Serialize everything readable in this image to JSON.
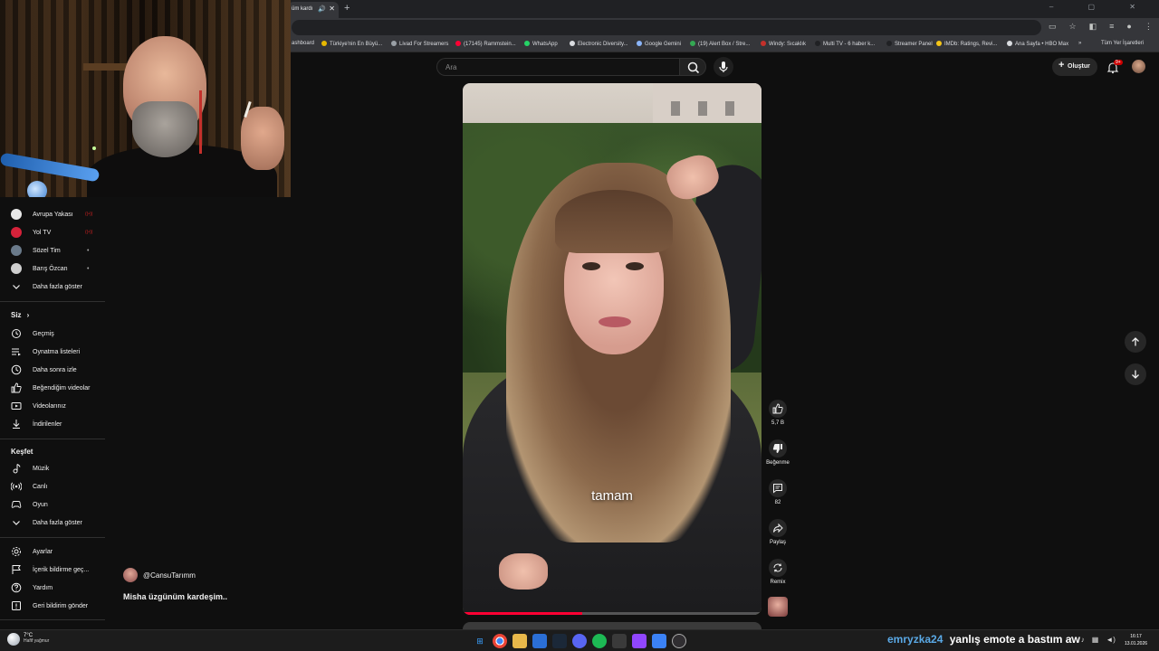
{
  "browser": {
    "tab_title": "üm kardı",
    "new_tab": "+",
    "window_controls": "– ▢ ✕"
  },
  "bookmarks": [
    {
      "label": "ashboard",
      "color": ""
    },
    {
      "label": "Türkiye'nin En Büyü...",
      "color": "#e6b800"
    },
    {
      "label": "Livad For Streamers",
      "color": "#9aa0a6"
    },
    {
      "label": "(17145) Rammstein...",
      "color": "#ff0033"
    },
    {
      "label": "WhatsApp",
      "color": "#25d366"
    },
    {
      "label": "Electronic Diversity...",
      "color": "#dadce0"
    },
    {
      "label": "Google Gemini",
      "color": "#8ab4f8"
    },
    {
      "label": "(19) Alert Box / Stre...",
      "color": "#34a853"
    },
    {
      "label": "Windy: Sıcaklık",
      "color": "#c4302b"
    },
    {
      "label": "Multi TV - 6 haber k...",
      "color": "#202124"
    },
    {
      "label": "Streamer Panel",
      "color": "#202124"
    },
    {
      "label": "IMDb: Ratings, Revi...",
      "color": "#f5c518"
    },
    {
      "label": "Ana Sayfa • HBO Max",
      "color": "#dadce0"
    },
    {
      "label": "»",
      "color": ""
    },
    {
      "label": "Tüm Yer İşaretleri",
      "color": ""
    }
  ],
  "header": {
    "search_placeholder": "Ara",
    "create_label": "Oluştur",
    "notif_count": "9+"
  },
  "sidebar": {
    "subscriptions": [
      {
        "label": "Avrupa Yakası",
        "mark": "((•))",
        "avatar": "#e8e8e8"
      },
      {
        "label": "Yol TV",
        "mark": "((•))",
        "avatar": "#d6223a"
      },
      {
        "label": "Sözel Tim",
        "mark": "•",
        "avatar": "#6a7a8a"
      },
      {
        "label": "Barış Özcan",
        "mark": "•",
        "avatar": "#cfcfcf"
      }
    ],
    "show_more_1": "Daha fazla göster",
    "you_heading": "Siz",
    "you_chevron": "›",
    "you_items": [
      {
        "label": "Geçmiş",
        "icon": "history-icon"
      },
      {
        "label": "Oynatma listeleri",
        "icon": "playlists-icon"
      },
      {
        "label": "Daha sonra izle",
        "icon": "clock-icon"
      },
      {
        "label": "Beğendiğim videolar",
        "icon": "thumbs-up-icon"
      },
      {
        "label": "Videolarınız",
        "icon": "video-icon"
      },
      {
        "label": "İndirilenler",
        "icon": "download-icon"
      }
    ],
    "explore_heading": "Keşfet",
    "explore_items": [
      {
        "label": "Müzik",
        "icon": "music-icon"
      },
      {
        "label": "Canlı",
        "icon": "live-icon"
      },
      {
        "label": "Oyun",
        "icon": "gaming-icon"
      }
    ],
    "show_more_2": "Daha fazla göster",
    "footer_items": [
      {
        "label": "Ayarlar",
        "icon": "gear-icon"
      },
      {
        "label": "İçerik bildirme geç...",
        "icon": "flag-icon"
      },
      {
        "label": "Yardım",
        "icon": "help-icon"
      },
      {
        "label": "Geri bildirim gönder",
        "icon": "feedback-icon"
      }
    ]
  },
  "short": {
    "caption": "tamam",
    "progress": 0.4,
    "channel": "@CansuTarımm",
    "title": "Misha üzgünüm kardeşim.."
  },
  "actions": {
    "like_count": "5,7 B",
    "dislike_label": "Beğenme",
    "comment_count": "82",
    "share_label": "Paylaş",
    "remix_label": "Remix"
  },
  "taskbar": {
    "temperature": "7°C",
    "weather": "Hafif yağmur",
    "chat_user": "emryzka24",
    "chat_message": "yanlış emote a bastım aw",
    "time": "16:17",
    "date": "13.01.2026"
  }
}
